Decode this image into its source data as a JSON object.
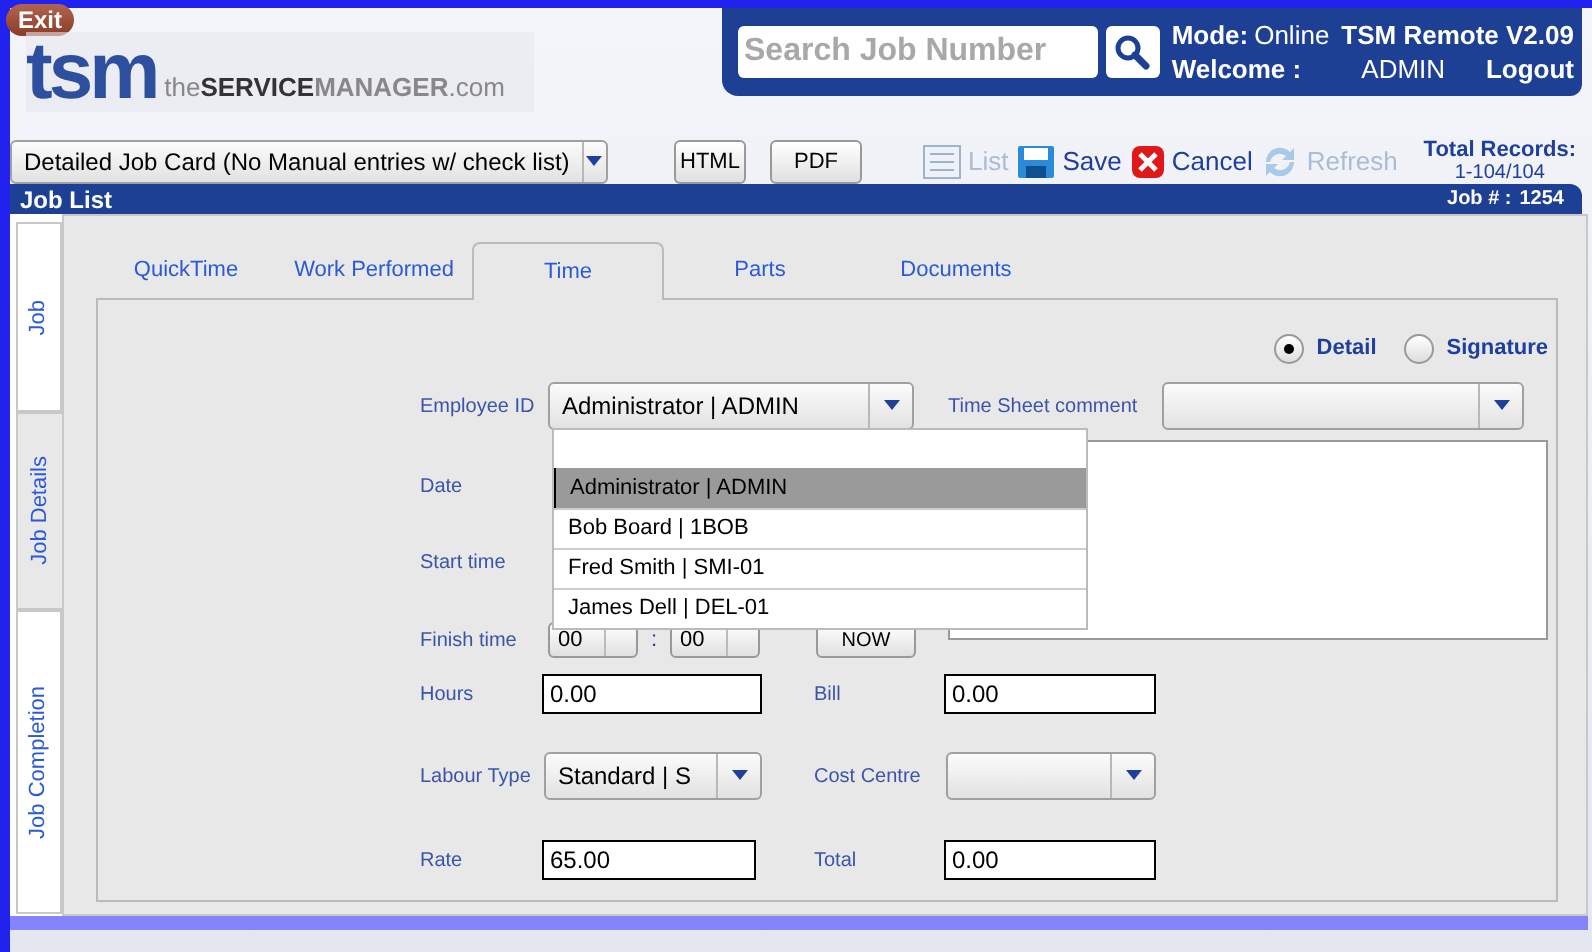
{
  "header": {
    "exit": "Exit",
    "logo": {
      "mark": "tsm",
      "the": "the",
      "service": "SERVICE",
      "manager": "MANAGER",
      "domain": ".com"
    },
    "search": {
      "placeholder": "Search Job Number"
    },
    "mode_label": "Mode:",
    "mode": "Online",
    "version": "TSM Remote V2.09",
    "welcome_label": "Welcome :",
    "user": "ADMIN",
    "logout": "Logout"
  },
  "toolbar": {
    "report": "Detailed Job Card (No Manual entries w/ check list)",
    "buttons": [
      {
        "label": "HTML"
      },
      {
        "label": "PDF"
      }
    ],
    "actions": [
      {
        "kind": "list",
        "label": "List",
        "disabled": true
      },
      {
        "kind": "save",
        "label": "Save",
        "disabled": false
      },
      {
        "kind": "cancel",
        "label": "Cancel",
        "disabled": false
      },
      {
        "kind": "refresh",
        "label": "Refresh",
        "disabled": true
      }
    ],
    "total_label": "Total Records:",
    "total": "1-104/104"
  },
  "panel": {
    "title": "Job List",
    "job_label": "Job # :",
    "job_number": "1254"
  },
  "side_tabs": [
    {
      "label": "Job",
      "selected": false
    },
    {
      "label": "Job Details",
      "selected": true
    },
    {
      "label": "Job Completion",
      "selected": false
    }
  ],
  "tabs": [
    {
      "label": "QuickTime",
      "selected": false
    },
    {
      "label": "Work Performed",
      "selected": false
    },
    {
      "label": "Time",
      "selected": true
    },
    {
      "label": "Parts",
      "selected": false
    },
    {
      "label": "Documents",
      "selected": false
    }
  ],
  "view": [
    {
      "label": "Detail",
      "selected": true
    },
    {
      "label": "Signature",
      "selected": false
    }
  ],
  "form": {
    "employee_label": "Employee ID",
    "employee": "Administrator | ADMIN",
    "comment_label": "Time Sheet comment",
    "date_label": "Date",
    "start_label": "Start time",
    "finish_label": "Finish time",
    "finish_hour": "00",
    "finish_sep": ":",
    "finish_minute": "00",
    "now": "NOW",
    "hours_label": "Hours",
    "hours": "0.00",
    "bill_label": "Bill",
    "bill": "0.00",
    "labour_label": "Labour Type",
    "labour": "Standard | S",
    "cost_label": "Cost Centre",
    "rate_label": "Rate",
    "rate": "65.00",
    "total_label": "Total",
    "total": "0.00"
  },
  "employee_options": [
    {
      "label": "Administrator | ADMIN",
      "selected": true
    },
    {
      "label": "Bob Board | 1BOB",
      "selected": false
    },
    {
      "label": "Fred Smith | SMI-01",
      "selected": false
    },
    {
      "label": "James Dell | DEL-01",
      "selected": false
    }
  ]
}
